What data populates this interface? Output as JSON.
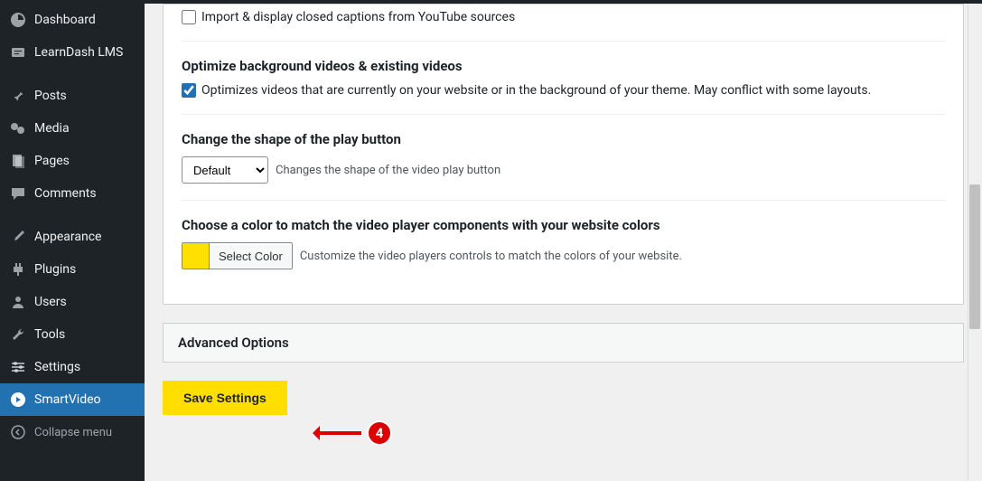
{
  "sidebar": {
    "items": [
      {
        "label": "Dashboard"
      },
      {
        "label": "LearnDash LMS"
      },
      {
        "label": "Posts"
      },
      {
        "label": "Media"
      },
      {
        "label": "Pages"
      },
      {
        "label": "Comments"
      },
      {
        "label": "Appearance"
      },
      {
        "label": "Plugins"
      },
      {
        "label": "Users"
      },
      {
        "label": "Tools"
      },
      {
        "label": "Settings"
      },
      {
        "label": "SmartVideo"
      }
    ],
    "collapse": "Collapse menu"
  },
  "settings": {
    "captions": {
      "label": "Import & display closed captions from YouTube sources"
    },
    "optimize": {
      "title": "Optimize background videos & existing videos",
      "label": "Optimizes videos that are currently on your website or in the background of your theme. May conflict with some layouts."
    },
    "playbutton": {
      "title": "Change the shape of the play button",
      "selected": "Default",
      "helper": "Changes the shape of the video play button"
    },
    "color": {
      "title": "Choose a color to match the video player components with your website colors",
      "swatch": "#ffe000",
      "button": "Select Color",
      "helper": "Customize the video players controls to match the colors of your website."
    },
    "advanced": "Advanced Options",
    "save": "Save Settings"
  },
  "annotation": {
    "step": "4"
  }
}
